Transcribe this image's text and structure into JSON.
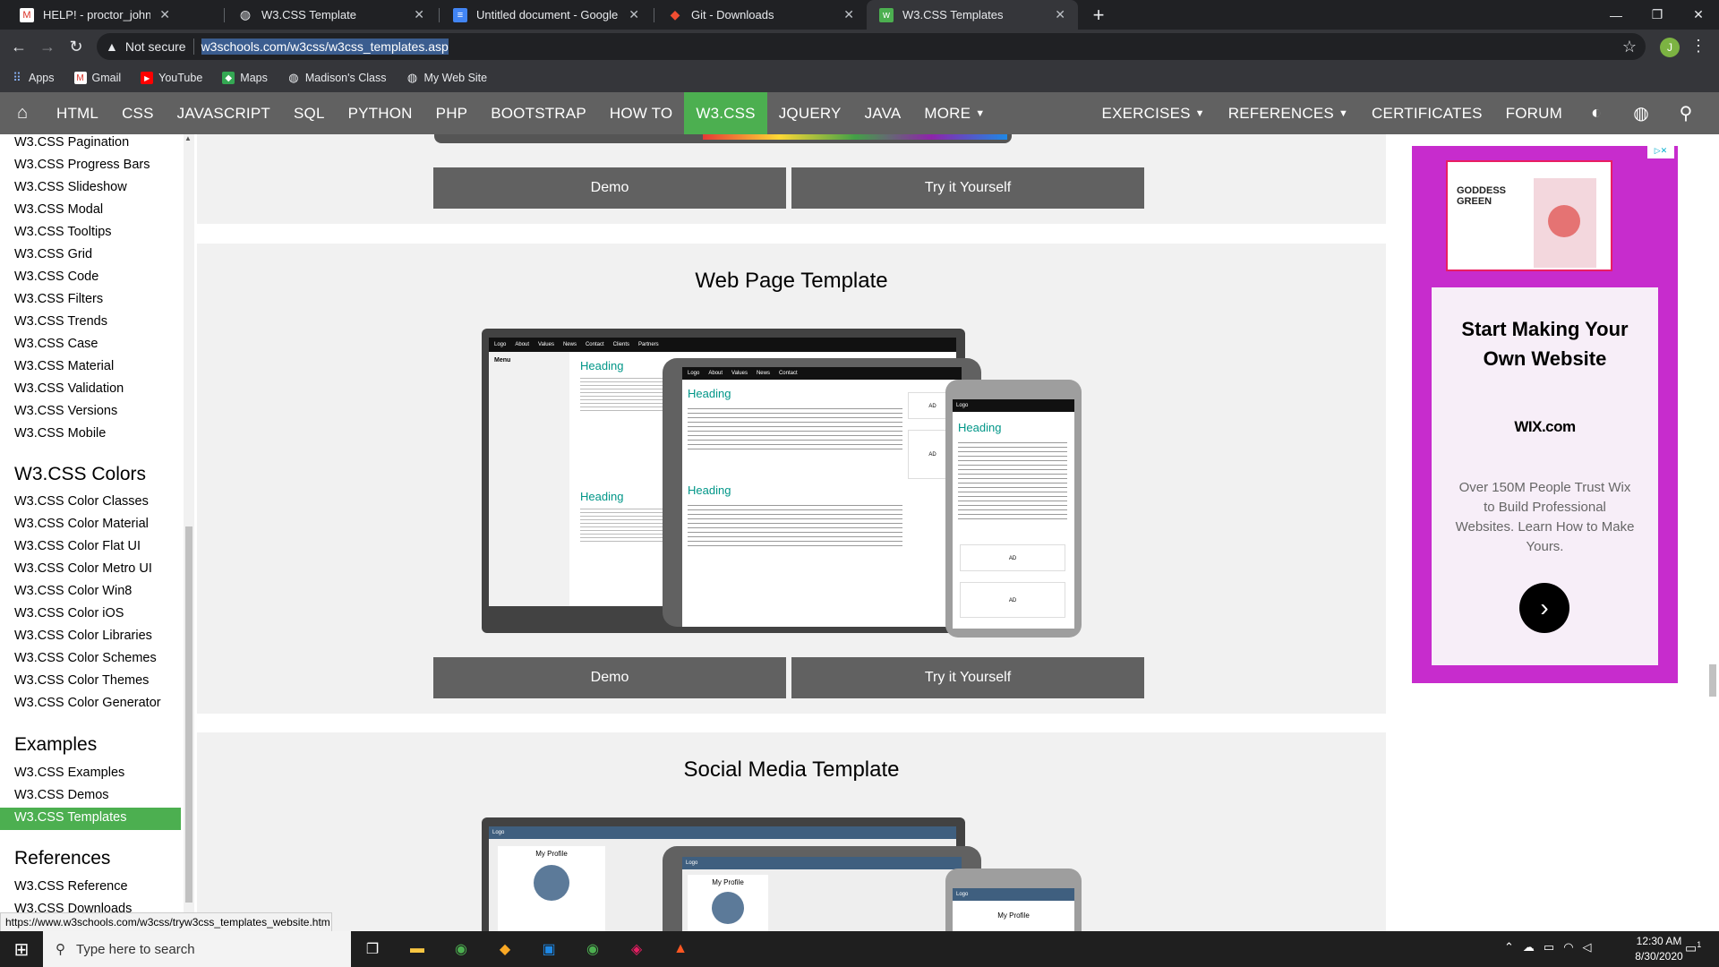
{
  "browser": {
    "tabs": [
      {
        "label": "HELP! - proctor_john@wheatonc",
        "icon": "gmail-icon"
      },
      {
        "label": "W3.CSS Template",
        "icon": "globe-icon"
      },
      {
        "label": "Untitled document - Google Doc",
        "icon": "docs-icon"
      },
      {
        "label": "Git - Downloads",
        "icon": "git-icon"
      },
      {
        "label": "W3.CSS Templates",
        "icon": "w3schools-icon",
        "active": true
      }
    ],
    "security_label": "Not secure",
    "url": "w3schools.com/w3css/w3css_templates.asp",
    "profile_initial": "J",
    "bookmarks": [
      "Apps",
      "Gmail",
      "YouTube",
      "Maps",
      "Madison's Class",
      "My Web Site"
    ]
  },
  "topnav": {
    "items": [
      "HTML",
      "CSS",
      "JAVASCRIPT",
      "SQL",
      "PYTHON",
      "PHP",
      "BOOTSTRAP",
      "HOW TO",
      "W3.CSS",
      "JQUERY",
      "JAVA",
      "MORE"
    ],
    "active": "W3.CSS",
    "right_items": [
      "EXERCISES",
      "REFERENCES",
      "CERTIFICATES",
      "FORUM"
    ]
  },
  "sidebar": {
    "links_top": [
      "W3.CSS Pagination",
      "W3.CSS Progress Bars",
      "W3.CSS Slideshow",
      "W3.CSS Modal",
      "W3.CSS Tooltips",
      "W3.CSS Grid",
      "W3.CSS Code",
      "W3.CSS Filters",
      "W3.CSS Trends",
      "W3.CSS Case",
      "W3.CSS Material",
      "W3.CSS Validation",
      "W3.CSS Versions",
      "W3.CSS Mobile"
    ],
    "colors_heading": "W3.CSS Colors",
    "colors_links": [
      "W3.CSS Color Classes",
      "W3.CSS Color Material",
      "W3.CSS Color Flat UI",
      "W3.CSS Color Metro UI",
      "W3.CSS Color Win8",
      "W3.CSS Color iOS",
      "W3.CSS Color Libraries",
      "W3.CSS Color Schemes",
      "W3.CSS Color Themes",
      "W3.CSS Color Generator"
    ],
    "examples_heading": "Examples",
    "examples_links": [
      "W3.CSS Examples",
      "W3.CSS Demos",
      "W3.CSS Templates"
    ],
    "references_heading": "References",
    "references_links": [
      "W3.CSS Reference",
      "W3.CSS Downloads"
    ]
  },
  "main": {
    "demo_label": "Demo",
    "try_label": "Try it Yourself",
    "sections": [
      {
        "title": "Web Page Template"
      },
      {
        "title": "Social Media Template"
      }
    ],
    "mock": {
      "nav": [
        "Logo",
        "About",
        "Values",
        "News",
        "Contact",
        "Clients",
        "Partners"
      ],
      "heading": "Heading",
      "menu": "Menu",
      "ad": "AD",
      "profile": "My Profile"
    }
  },
  "ad": {
    "banner_text": "GODDESS GREEN",
    "headline": "Start Making Your Own Website",
    "brand": "WIX.com",
    "body": "Over 150M People Trust Wix to Build Professional Websites. Learn How to Make Yours."
  },
  "status_url": "https://www.w3schools.com/w3css/tryw3css_templates_website.htm",
  "taskbar": {
    "search_placeholder": "Type here to search",
    "time": "12:30 AM",
    "date": "8/30/2020",
    "notification_count": "1"
  }
}
